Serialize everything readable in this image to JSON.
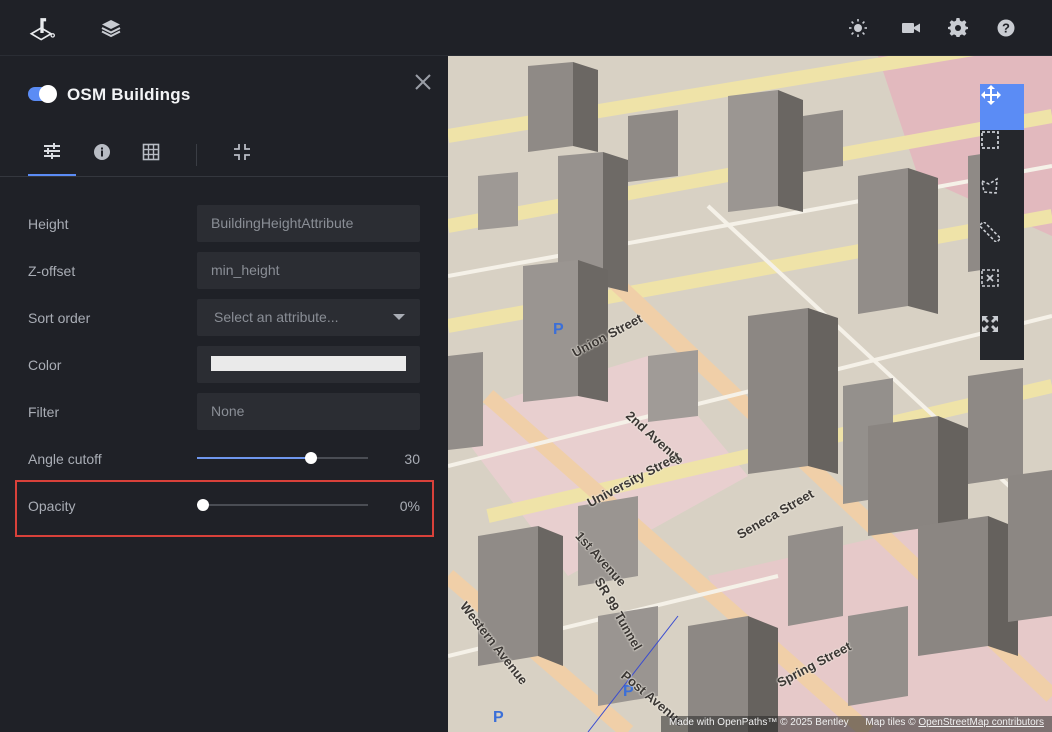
{
  "panel": {
    "title": "OSM Buildings",
    "layer_enabled": true
  },
  "fields": {
    "height_label": "Height",
    "height_value": "BuildingHeightAttribute",
    "zoffset_label": "Z-offset",
    "zoffset_value": "min_height",
    "sort_label": "Sort order",
    "sort_placeholder": "Select an attribute...",
    "color_label": "Color",
    "color_value": "#eaeaea",
    "filter_label": "Filter",
    "filter_value": "None",
    "angle_label": "Angle cutoff",
    "angle_value": "30",
    "angle_fraction": 0.664,
    "opacity_label": "Opacity",
    "opacity_value": "0%",
    "opacity_fraction": 0.0
  },
  "map": {
    "streets": [
      "1st Avenue",
      "2nd Avenue",
      "Western Avenue",
      "Post Avenue",
      "Seneca Street",
      "Spring Street",
      "University Street",
      "SR 99 Tunnel",
      "Union Street"
    ],
    "attribution_made_with": "Made with OpenPaths™ © 2025 Bentley",
    "attribution_tiles_prefix": "Map tiles ©",
    "attribution_link": "OpenStreetMap contributors"
  },
  "colors": {
    "accent": "#5b8cf5",
    "highlight_box": "#d9413a",
    "panel_bg": "#1f2127"
  }
}
